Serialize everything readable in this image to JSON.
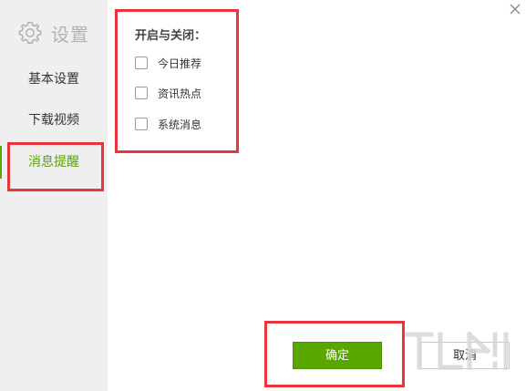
{
  "sidebar": {
    "title": "设置",
    "header_icon": "gear-icon",
    "items": [
      {
        "label": "基本设置",
        "active": false
      },
      {
        "label": "下载视频",
        "active": false
      },
      {
        "label": "消息提醒",
        "active": true
      }
    ]
  },
  "main": {
    "section_title": "开启与关闭：",
    "options": [
      {
        "label": "今日推荐",
        "checked": false
      },
      {
        "label": "资讯热点",
        "checked": false
      },
      {
        "label": "系统消息",
        "checked": false
      }
    ],
    "close_icon": "close-icon"
  },
  "footer": {
    "ok_label": "确定",
    "cancel_label": "取消"
  },
  "colors": {
    "accent": "#5aa600",
    "sidebar_bg": "#efefef",
    "highlight": "#e8343a"
  }
}
